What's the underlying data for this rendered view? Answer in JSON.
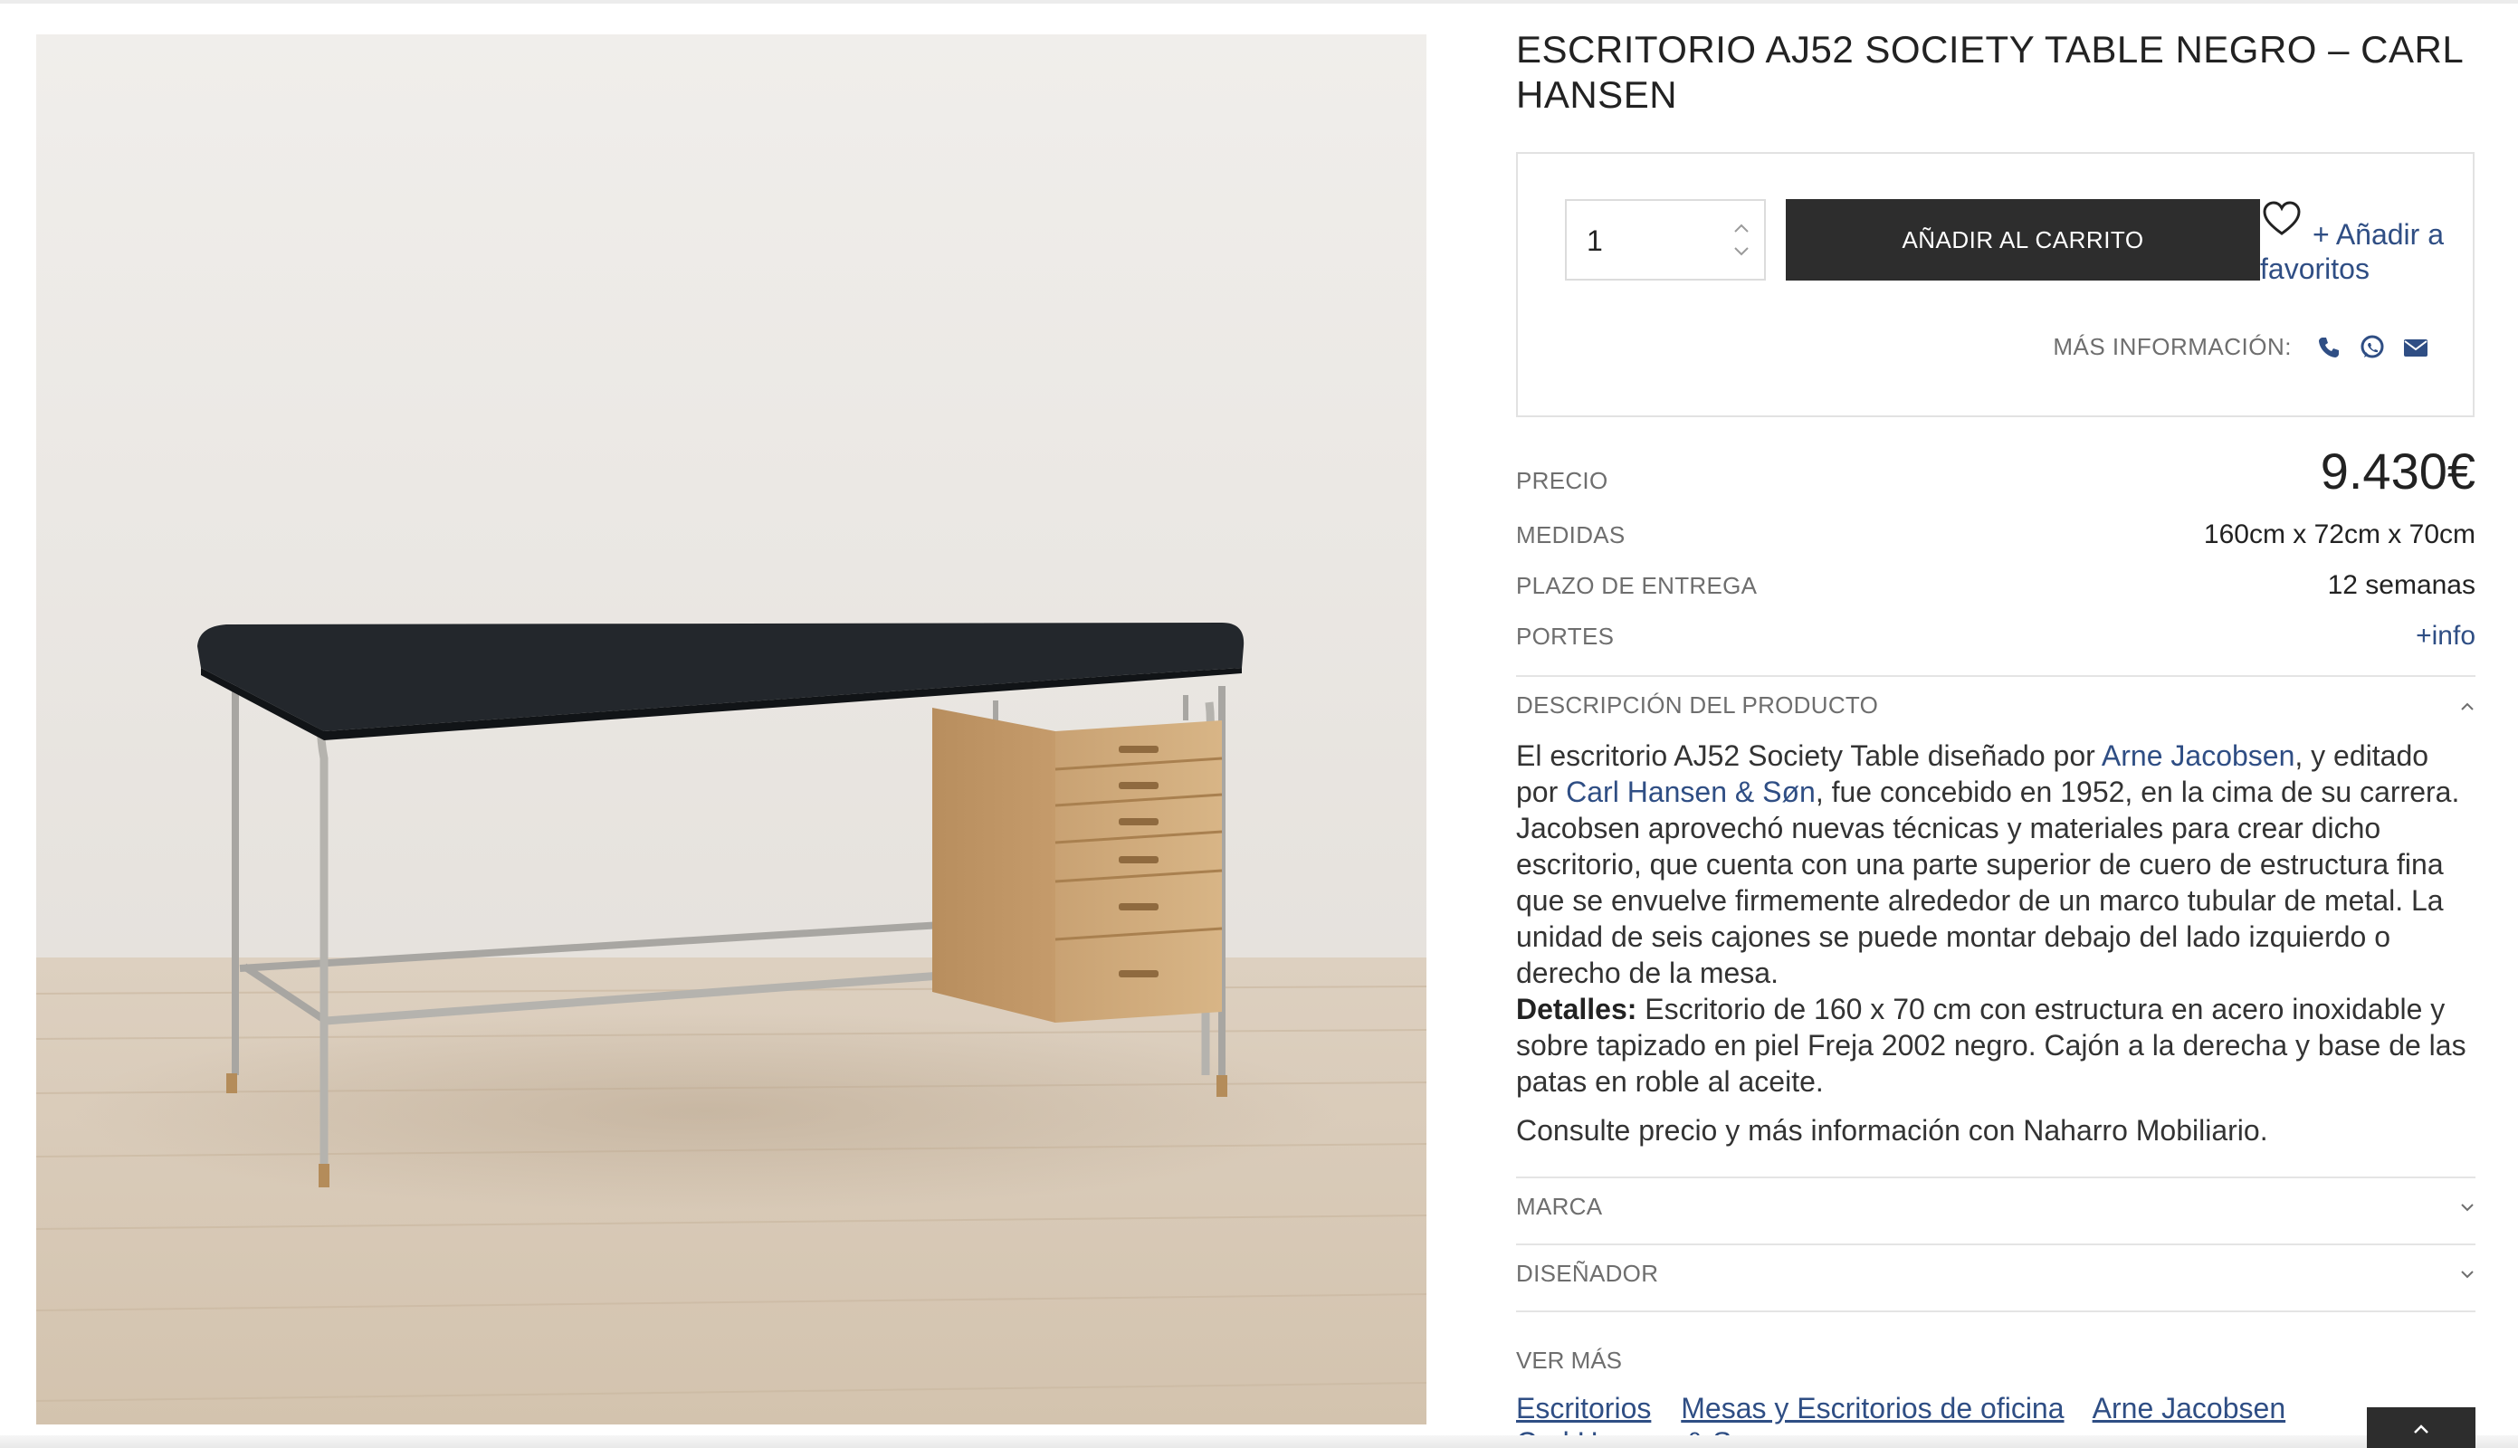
{
  "product": {
    "title": "ESCRITORIO AJ52 SOCIETY TABLE NEGRO – CARL HANSEN",
    "image_alt": "product-photo-desk"
  },
  "purchase": {
    "quantity": "1",
    "add_to_cart": "AÑADIR AL CARRITO",
    "add_favorites": "+ Añadir a favoritos",
    "more_info_label": "MÁS INFORMACIÓN:",
    "contact_icons": [
      "phone-icon",
      "whatsapp-icon",
      "envelope-icon"
    ]
  },
  "specs": {
    "price_label": "PRECIO",
    "price_value": "9.430€",
    "size_label": "MEDIDAS",
    "size_value": "160cm x 72cm x 70cm",
    "delivery_label": "PLAZO DE ENTREGA",
    "delivery_value": "12 semanas",
    "shipping_label": "PORTES",
    "shipping_value": "+info"
  },
  "description": {
    "heading": "DESCRIPCIÓN DEL PRODUCTO",
    "p1_a": "El escritorio AJ52 Society Table diseñado por ",
    "p1_link1": "Arne Jacobsen",
    "p1_b": ", y  editado por ",
    "p1_link2": "Carl Hansen & Søn",
    "p1_c": ",  fue concebido en 1952, en la cima de su carrera. Jacobsen aprovechó nuevas técnicas y materiales para crear dicho escritorio, que cuenta con una parte superior de cuero de estructura fina que se envuelve firmemente alrededor de un marco tubular de metal. La unidad de seis cajones se puede montar debajo del lado izquierdo o derecho de la mesa.",
    "details_label": "Detalles:",
    "details_text": " Escritorio de 160 x 70 cm con estructura en acero inoxidable y sobre tapizado en piel Freja 2002 negro. Cajón a la derecha y base de las patas en roble al aceite.",
    "consult": "Consulte precio y más información con Naharro Mobiliario."
  },
  "sections": {
    "brand": "MARCA",
    "designer": "DISEÑADOR"
  },
  "see_more": {
    "label": "VER MÁS",
    "tags": [
      "Escritorios",
      "Mesas y Escritorios de oficina",
      "Arne Jacobsen",
      "Carl Hansen & Søn"
    ]
  },
  "colors": {
    "accent_link": "#2f4e84",
    "button_dark": "#2d2d2d",
    "muted_text": "#6e6e6e",
    "border": "#e2e2e2"
  }
}
